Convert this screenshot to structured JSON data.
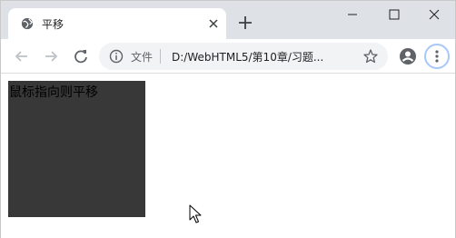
{
  "tab": {
    "title": "平移",
    "favicon": "globe-icon",
    "close_icon": "close-icon"
  },
  "new_tab_icon": "plus-icon",
  "window_controls": [
    "minimize-icon",
    "maximize-icon",
    "close-icon"
  ],
  "toolbar": {
    "back_icon": "arrow-left-icon",
    "forward_icon": "arrow-right-icon",
    "reload_icon": "reload-icon",
    "omnibox": {
      "info_icon": "info-icon",
      "scheme_label": "文件",
      "url": "D:/WebHTML5/第10章/习题...",
      "star_icon": "star-icon"
    },
    "profile_icon": "account-icon",
    "menu_icon": "more-vert-icon"
  },
  "page": {
    "box_text": "鼠标指向则平移",
    "box_color": "#383838"
  },
  "colors": {
    "tabstrip": "#dee1e6",
    "omnibox": "#f1f3f4",
    "menu_ring": "#a8c7fa"
  }
}
